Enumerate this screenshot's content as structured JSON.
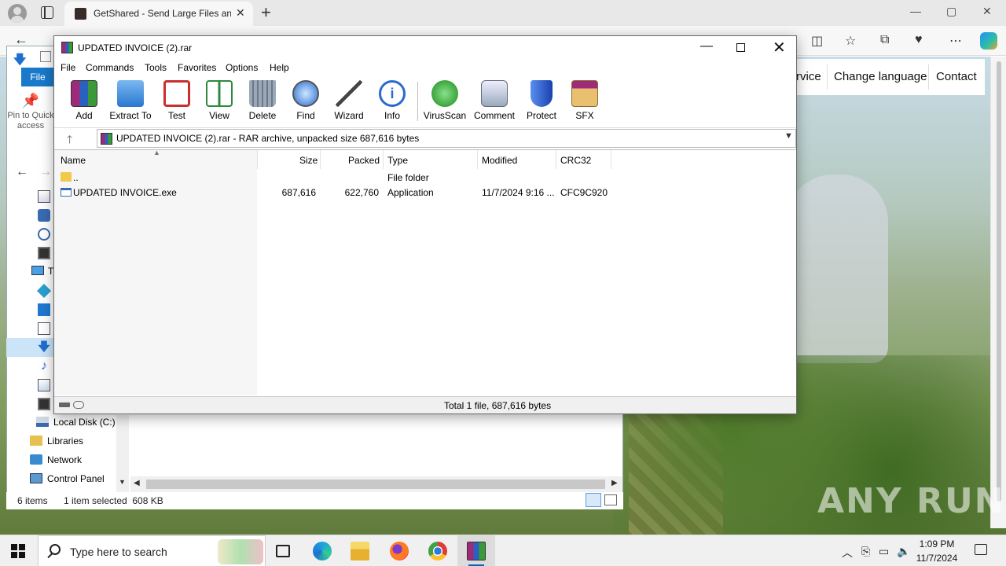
{
  "browser": {
    "tab_title": "GetShared - Send Large Files and",
    "tab_close": "✕",
    "new_tab": "+",
    "back": "←",
    "window_controls": {
      "minimize": "—",
      "maximize": "▢",
      "close": "✕"
    },
    "toolbar_icons": [
      "split-screen-icon",
      "favorites-icon",
      "collections-icon",
      "performance-icon",
      "more-icon",
      "copilot-icon"
    ]
  },
  "webpage": {
    "nav": [
      "rvice",
      "Change language",
      "Contact"
    ],
    "watermark": "ANY RUN"
  },
  "explorer": {
    "file_tab": "File",
    "pin_label": "Pin to Quick access",
    "tree": [
      "Local Disk (C:)",
      "Libraries",
      "Network",
      "Control Panel"
    ],
    "status_items": "6 items",
    "status_selected": "1 item selected  608 KB"
  },
  "winrar": {
    "title": "UPDATED INVOICE (2).rar",
    "menu": [
      "File",
      "Commands",
      "Tools",
      "Favorites",
      "Options",
      "Help"
    ],
    "tools": [
      {
        "label": "Add",
        "icon": "add-icon",
        "color": "#8a2a6a"
      },
      {
        "label": "Extract To",
        "icon": "extract-folder-icon",
        "color": "#3a8ad8"
      },
      {
        "label": "Test",
        "icon": "test-clipboard-icon",
        "color": "#c83030"
      },
      {
        "label": "View",
        "icon": "view-book-icon",
        "color": "#2e8a3e"
      },
      {
        "label": "Delete",
        "icon": "delete-trash-icon",
        "color": "#7a8a9a"
      },
      {
        "label": "Find",
        "icon": "find-magnifier-icon",
        "color": "#2a6ad0"
      },
      {
        "label": "Wizard",
        "icon": "wizard-wand-icon",
        "color": "#606060"
      },
      {
        "label": "Info",
        "icon": "info-icon",
        "color": "#2a6ad0"
      },
      {
        "label": "VirusScan",
        "icon": "virusscan-bug-icon",
        "color": "#2aa02a"
      },
      {
        "label": "Comment",
        "icon": "comment-icon",
        "color": "#7a90b0"
      },
      {
        "label": "Protect",
        "icon": "protect-shield-icon",
        "color": "#2a60d0"
      },
      {
        "label": "SFX",
        "icon": "sfx-box-icon",
        "color": "#e0a040"
      }
    ],
    "path": "UPDATED INVOICE (2).rar - RAR archive, unpacked size 687,616 bytes",
    "columns": {
      "name": "Name",
      "size": "Size",
      "packed": "Packed",
      "type": "Type",
      "modified": "Modified",
      "crc": "CRC32"
    },
    "rows": [
      {
        "name": "..",
        "size": "",
        "packed": "",
        "type": "File folder",
        "modified": "",
        "crc": ""
      },
      {
        "name": "UPDATED INVOICE.exe",
        "size": "687,616",
        "packed": "622,760",
        "type": "Application",
        "modified": "11/7/2024 9:16 ...",
        "crc": "CFC9C920"
      }
    ],
    "status": "Total 1 file, 687,616 bytes"
  },
  "taskbar": {
    "search_placeholder": "Type here to search",
    "time": "1:09 PM",
    "date": "11/7/2024"
  }
}
